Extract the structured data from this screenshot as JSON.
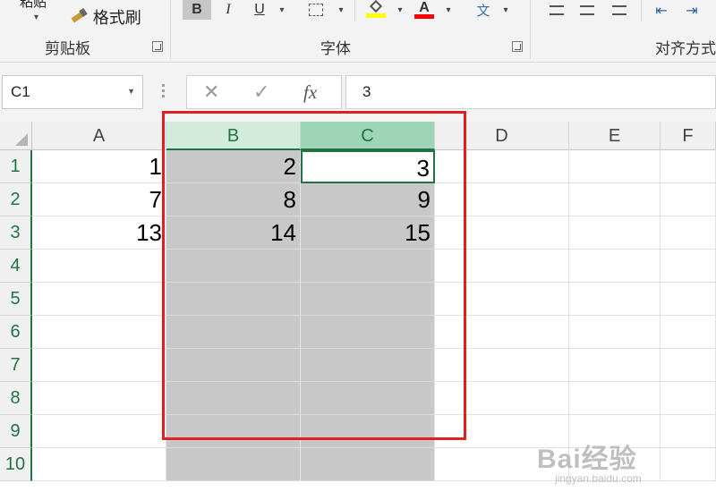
{
  "ribbon": {
    "paste_label": "粘贴",
    "format_painter_label": "格式刷",
    "clipboard_label": "剪贴板",
    "font_group_label": "字体",
    "align_group_label": "对齐方式",
    "bold_label": "B",
    "italic_label": "I",
    "underline_label": "U",
    "font_color_label": "A",
    "wen_label": "文",
    "highlight_color": "#ffff00",
    "font_color": "#ff0000"
  },
  "formula_bar": {
    "name_box": "C1",
    "cancel_icon": "✕",
    "enter_icon": "✓",
    "fx_label": "fx",
    "value": "3"
  },
  "columns": [
    "A",
    "B",
    "C",
    "D",
    "E",
    "F"
  ],
  "rows": [
    "1",
    "2",
    "3",
    "4",
    "5",
    "6",
    "7",
    "8",
    "9",
    "10"
  ],
  "cells": {
    "A1": "1",
    "B1": "2",
    "C1": "3",
    "A2": "7",
    "B2": "8",
    "C2": "9",
    "A3": "13",
    "B3": "14",
    "C3": "15"
  },
  "selection": {
    "range": "B:C",
    "active_cell": "C1"
  },
  "colors": {
    "accent": "#217346",
    "highlight_box": "#e02020",
    "selection_fill": "#c8c8c8"
  },
  "watermark": {
    "main": "Bai经验",
    "sub": "jingyan.baidu.com"
  }
}
